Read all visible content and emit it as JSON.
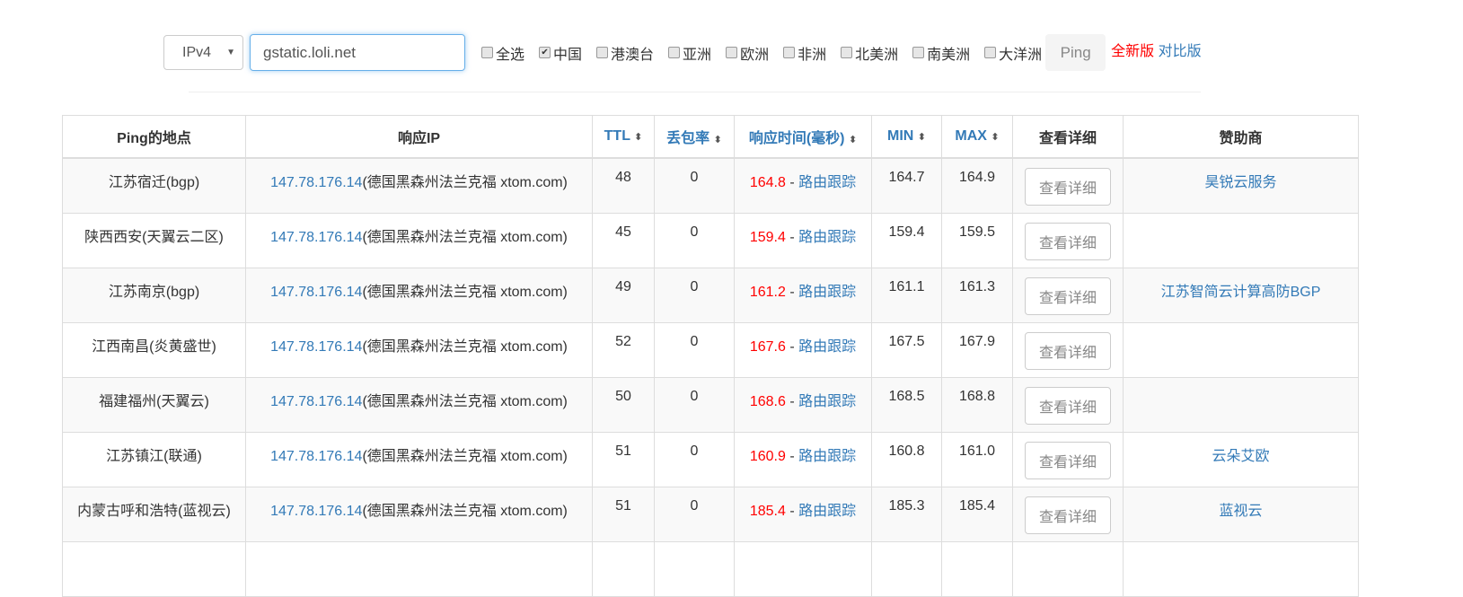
{
  "form": {
    "ip_version": "IPv4",
    "host": "gstatic.loli.net",
    "regions": [
      {
        "label": "全选",
        "checked": false
      },
      {
        "label": "中国",
        "checked": true
      },
      {
        "label": "港澳台",
        "checked": false
      },
      {
        "label": "亚洲",
        "checked": false
      },
      {
        "label": "欧洲",
        "checked": false
      },
      {
        "label": "非洲",
        "checked": false
      },
      {
        "label": "北美洲",
        "checked": false
      },
      {
        "label": "南美洲",
        "checked": false
      },
      {
        "label": "大洋洲",
        "checked": false
      }
    ],
    "ping_label": "Ping",
    "new_version": "全新版",
    "compare_version": "对比版"
  },
  "table": {
    "headers": [
      "Ping的地点",
      "响应IP",
      "TTL",
      "丢包率",
      "响应时间(毫秒)",
      "MIN",
      "MAX",
      "查看详细",
      "赞助商"
    ],
    "rows": [
      {
        "loc": "江苏宿迁(bgp)",
        "ip": "147.78.176.14",
        "geo": "(德国黑森州法兰克福 xtom.com)",
        "ttl": "48",
        "loss": "0",
        "time": "164.8",
        "trace": "路由跟踪",
        "min": "164.7",
        "max": "164.9",
        "detail": "查看详细",
        "sponsor": "昊锐云服务"
      },
      {
        "loc": "陕西西安(天翼云二区)",
        "ip": "147.78.176.14",
        "geo": "(德国黑森州法兰克福 xtom.com)",
        "ttl": "45",
        "loss": "0",
        "time": "159.4",
        "trace": "路由跟踪",
        "min": "159.4",
        "max": "159.5",
        "detail": "查看详细",
        "sponsor": ""
      },
      {
        "loc": "江苏南京(bgp)",
        "ip": "147.78.176.14",
        "geo": "(德国黑森州法兰克福 xtom.com)",
        "ttl": "49",
        "loss": "0",
        "time": "161.2",
        "trace": "路由跟踪",
        "min": "161.1",
        "max": "161.3",
        "detail": "查看详细",
        "sponsor": "江苏智简云计算高防BGP"
      },
      {
        "loc": "江西南昌(炎黄盛世)",
        "ip": "147.78.176.14",
        "geo": "(德国黑森州法兰克福 xtom.com)",
        "ttl": "52",
        "loss": "0",
        "time": "167.6",
        "trace": "路由跟踪",
        "min": "167.5",
        "max": "167.9",
        "detail": "查看详细",
        "sponsor": ""
      },
      {
        "loc": "福建福州(天翼云)",
        "ip": "147.78.176.14",
        "geo": "(德国黑森州法兰克福 xtom.com)",
        "ttl": "50",
        "loss": "0",
        "time": "168.6",
        "trace": "路由跟踪",
        "min": "168.5",
        "max": "168.8",
        "detail": "查看详细",
        "sponsor": ""
      },
      {
        "loc": "江苏镇江(联通)",
        "ip": "147.78.176.14",
        "geo": "(德国黑森州法兰克福 xtom.com)",
        "ttl": "51",
        "loss": "0",
        "time": "160.9",
        "trace": "路由跟踪",
        "min": "160.8",
        "max": "161.0",
        "detail": "查看详细",
        "sponsor": "云朵艾欧"
      },
      {
        "loc": "内蒙古呼和浩特(蓝视云)",
        "ip": "147.78.176.14",
        "geo": "(德国黑森州法兰克福 xtom.com)",
        "ttl": "51",
        "loss": "0",
        "time": "185.4",
        "trace": "路由跟踪",
        "min": "185.3",
        "max": "185.4",
        "detail": "查看详细",
        "sponsor": "蓝视云"
      }
    ]
  }
}
